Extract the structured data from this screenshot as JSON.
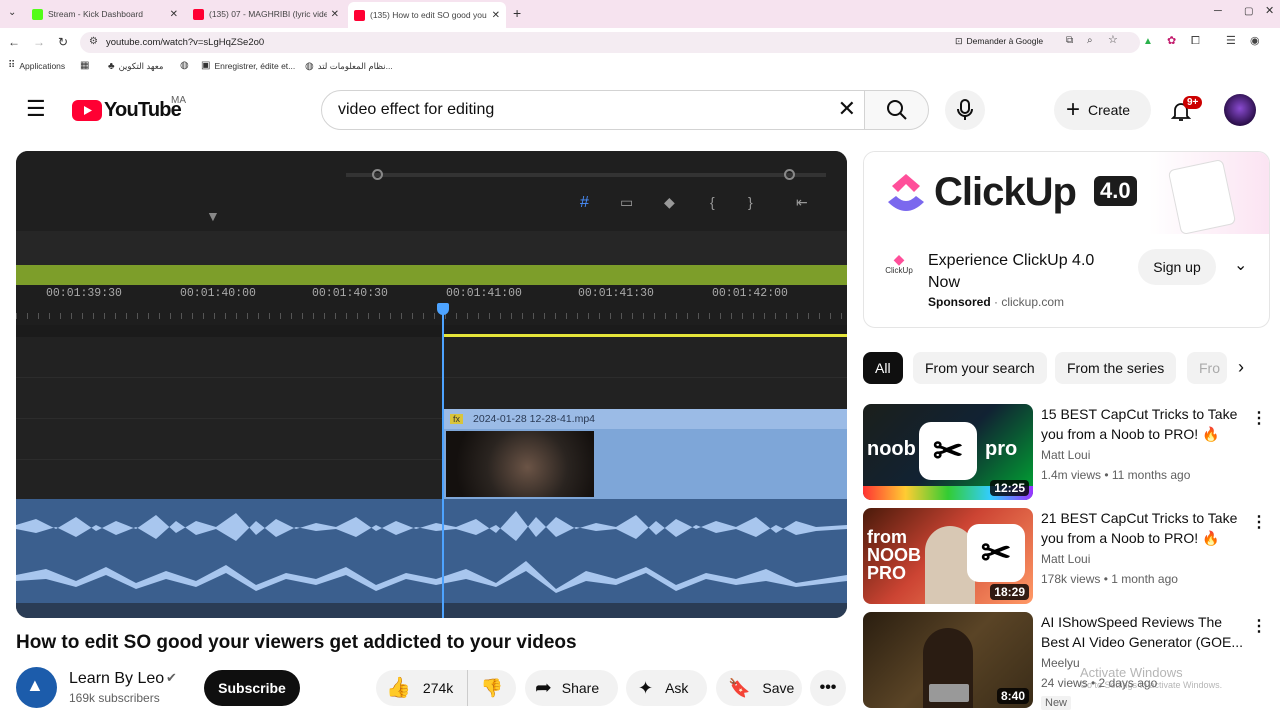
{
  "browser": {
    "tabs": [
      {
        "title": "Stream - Kick Dashboard",
        "color": "#53fc18"
      },
      {
        "title": "(135) 07 - MAGHRIBI (lyric vide",
        "color": "#ff0033"
      },
      {
        "title": "(135) How to edit SO good you",
        "color": "#ff0033"
      }
    ],
    "url": "youtube.com/watch?v=sLgHqZSe2o0",
    "translate_label": "Demander à Google",
    "bookmarks": [
      "Applications",
      "معهد التكوين",
      "Enregistrer, édite et...",
      "نظام المعلومات لتد..."
    ]
  },
  "youtube": {
    "logo_text": "YouTube",
    "country": "MA",
    "search_value": "video effect for editing",
    "create_label": "Create",
    "notif_badge": "9+"
  },
  "player": {
    "timecodes": [
      "00:01:39:30",
      "00:01:40:00",
      "00:01:40:30",
      "00:01:41:00",
      "00:01:41:30",
      "00:01:42:00"
    ],
    "clip_name": "2024-01-28 12-28-41.mp4",
    "clip_fx": "fx"
  },
  "video": {
    "title": "How to edit SO good your viewers get addicted to your videos",
    "channel": "Learn By Leo",
    "subscribers": "169k subscribers",
    "subscribe_label": "Subscribe",
    "likes": "274k",
    "share_label": "Share",
    "ask_label": "Ask",
    "save_label": "Save"
  },
  "ad": {
    "brand": "ClickUp",
    "version": "4.0",
    "logo_small": "ClickUp",
    "title": "Experience ClickUp 4.0 Now",
    "sponsored": "Sponsored",
    "domain": "clickup.com",
    "cta": "Sign up"
  },
  "chips": [
    "All",
    "From your search",
    "From the series",
    "Fro"
  ],
  "recommendations": [
    {
      "title": "15 BEST CapCut Tricks to Take you from a Noob to PRO! 🔥",
      "channel": "Matt Loui",
      "meta": "1.4m views • 11 months ago",
      "duration": "12:25",
      "thumb_left": "noob",
      "thumb_right": "pro"
    },
    {
      "title": "21 BEST CapCut Tricks to Take you from a Noob to PRO! 🔥",
      "channel": "Matt Loui",
      "meta": "178k views • 1 month ago",
      "duration": "18:29",
      "thumb_left": "from NOOB PRO",
      "thumb_right": ""
    },
    {
      "title": "AI IShowSpeed Reviews The Best AI Video Generator (GOE...",
      "channel": "Meelyu",
      "meta": "24 views • 2 days ago",
      "duration": "8:40",
      "badge": "New"
    }
  ],
  "watermark": {
    "line1": "Activate Windows",
    "line2": "Go to Settings to activate Windows."
  }
}
